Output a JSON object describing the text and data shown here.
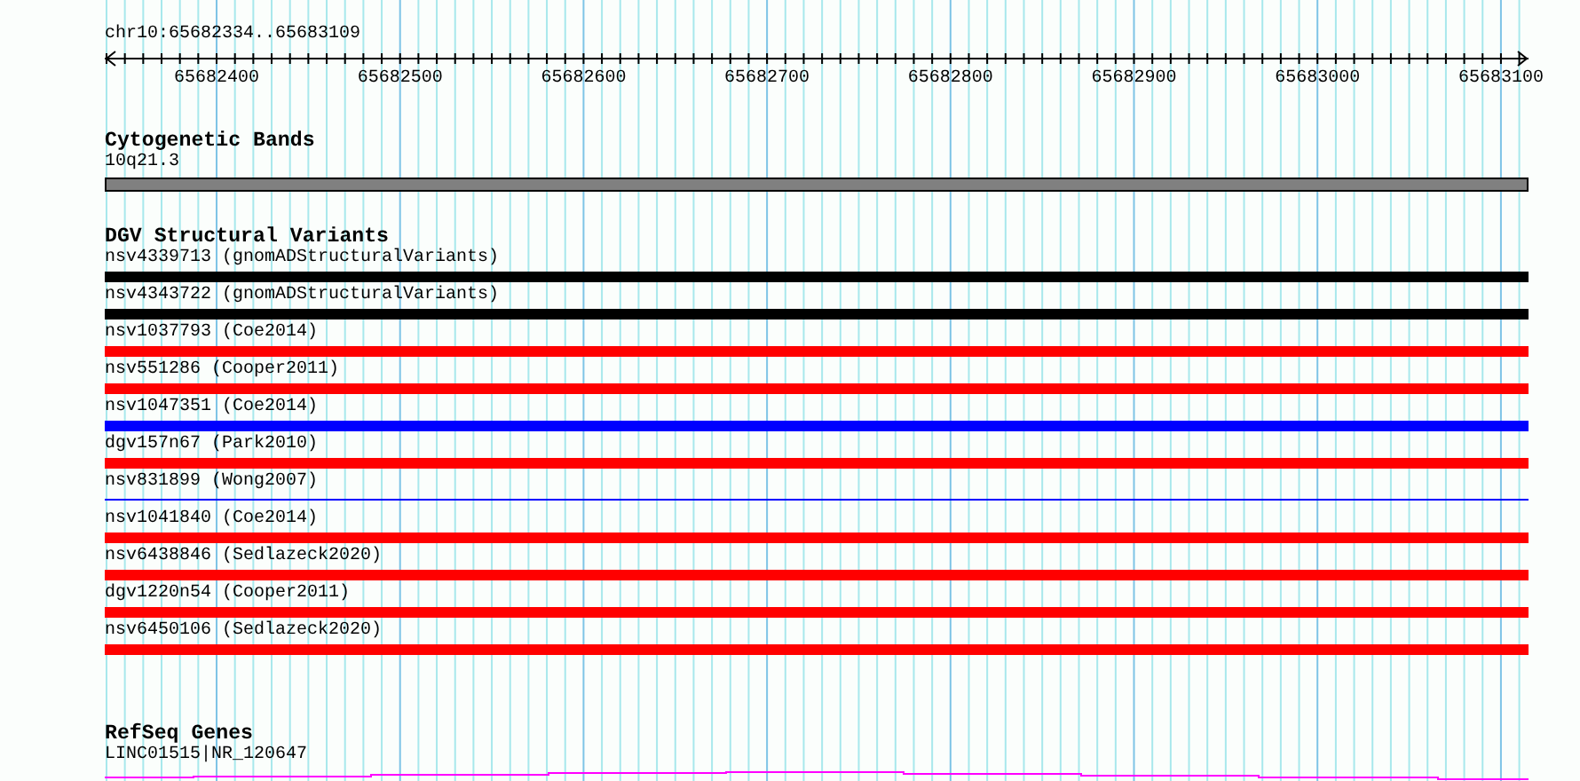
{
  "ruler": {
    "title": "chr10:65682334..65683109",
    "ticks": [
      "65682400",
      "65682500",
      "65682600",
      "65682700",
      "65682800",
      "65682900",
      "65683000",
      "65683100"
    ]
  },
  "cytogenetic_bands": {
    "title": "Cytogenetic Bands",
    "band": "10q21.3"
  },
  "dgv_structural_variants": {
    "title": "DGV Structural Variants",
    "features": [
      {
        "label": "nsv4339713 (gnomADStructuralVariants)",
        "kind": "bar",
        "color": "#000000"
      },
      {
        "label": "nsv4343722 (gnomADStructuralVariants)",
        "kind": "bar",
        "color": "#000000"
      },
      {
        "label": "nsv1037793 (Coe2014)",
        "kind": "bar",
        "color": "#ff0000"
      },
      {
        "label": "nsv551286 (Cooper2011)",
        "kind": "bar",
        "color": "#ff0000"
      },
      {
        "label": "nsv1047351 (Coe2014)",
        "kind": "bar",
        "color": "#0000ff"
      },
      {
        "label": "dgv157n67 (Park2010)",
        "kind": "bar",
        "color": "#ff0000"
      },
      {
        "label": "nsv831899 (Wong2007)",
        "kind": "line",
        "color": "#0000ff"
      },
      {
        "label": "nsv1041840 (Coe2014)",
        "kind": "bar",
        "color": "#ff0000"
      },
      {
        "label": "nsv6438846 (Sedlazeck2020)",
        "kind": "bar",
        "color": "#ff0000"
      },
      {
        "label": "dgv1220n54 (Cooper2011)",
        "kind": "bar",
        "color": "#ff0000"
      },
      {
        "label": "nsv6450106 (Sedlazeck2020)",
        "kind": "bar",
        "color": "#ff0000"
      }
    ]
  },
  "refseq_genes": {
    "title": "RefSeq Genes",
    "gene": "LINC01515|NR_120647"
  }
}
